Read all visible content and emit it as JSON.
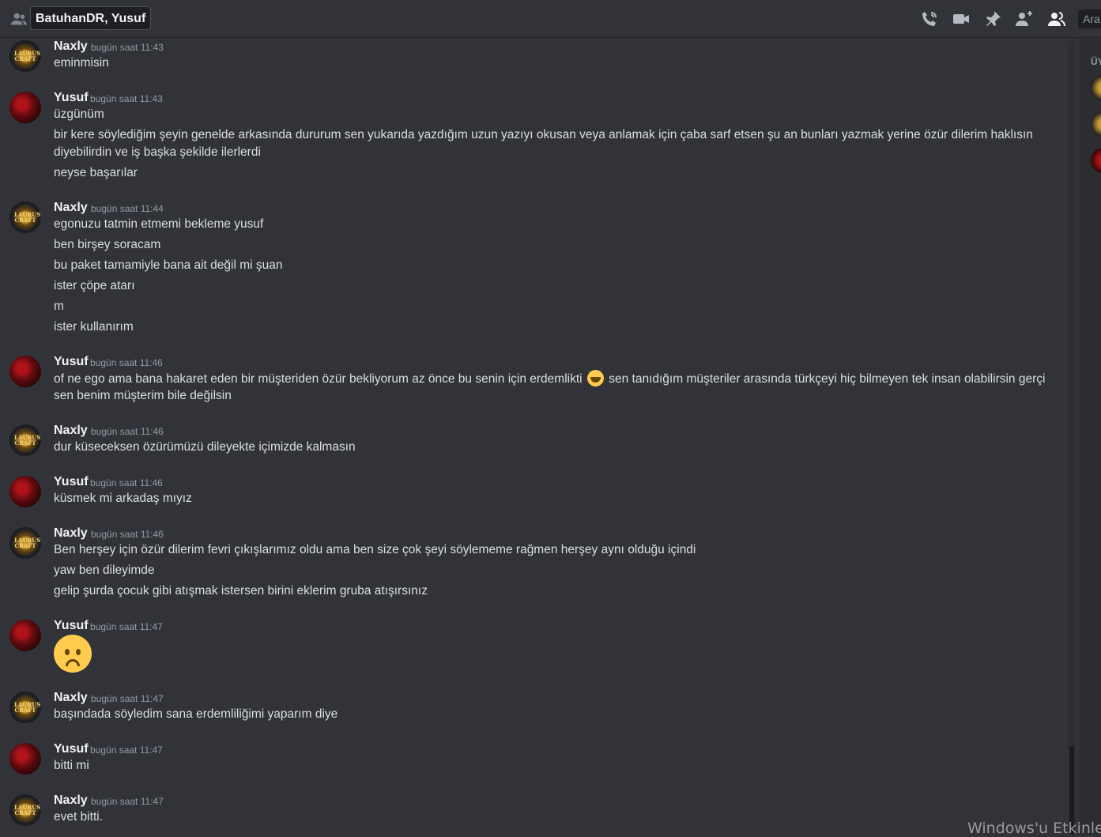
{
  "header": {
    "title": "BatuhanDR, Yusuf",
    "search_label": "Ara",
    "icons": [
      "friends-icon",
      "call-icon",
      "video-icon",
      "pin-icon",
      "add-member-icon",
      "members-icon"
    ]
  },
  "members_panel": {
    "heading": "ÜY"
  },
  "watermark": "Windows'u Etkinleş",
  "messages": [
    {
      "author": "Naxly",
      "time": "bugün saat 11:43",
      "lines": [
        "eminmisin"
      ]
    },
    {
      "author": "Yusuf",
      "time": "bugün saat 11:43",
      "lines": [
        "üzgünüm",
        "bir kere söylediğim şeyin genelde arkasında dururum sen yukarıda yazdığım uzun yazıyı okusan veya anlamak için çaba sarf etsen şu an bunları yazmak yerine özür dilerim haklısın",
        "diyebilirdin ve iş başka şekilde ilerlerdi",
        "neyse başarılar"
      ]
    },
    {
      "author": "Naxly",
      "time": "bugün saat 11:44",
      "lines": [
        "egonuzu tatmin etmemi bekleme yusuf",
        "ben birşey soracam",
        "bu paket tamamiyle bana ait değil mi şuan",
        "ister çöpe atarı",
        "m",
        "ister kullanırım"
      ]
    },
    {
      "author": "Yusuf",
      "time": "bugün saat 11:46",
      "lines": [
        "of ne ego ama bana hakaret eden bir müşteriden özür bekliyorum az önce bu senin için erdemlikti",
        "sen tanıdığım müşteriler arasında türkçeyi hiç bilmeyen tek insan olabilirsin gerçi",
        "sen benim müşterim bile değilsin"
      ]
    },
    {
      "author": "Naxly",
      "time": "bugün saat 11:46",
      "lines": [
        "dur küseceksen özürümüzü dileyekte içimizde kalmasın"
      ]
    },
    {
      "author": "Yusuf",
      "time": "bugün saat 11:46",
      "lines": [
        "küsmek mi arkadaş mıyız"
      ]
    },
    {
      "author": "Naxly",
      "time": "bugün saat 11:46",
      "lines": [
        "Ben herşey için özür dilerim fevri çıkışlarımız oldu ama ben size çok şeyi söylememe rağmen herşey aynı olduğu içindi",
        "yaw ben dileyimde",
        "gelip şurda çocuk gibi atışmak istersen birini eklerim gruba atışırsınız"
      ]
    },
    {
      "author": "Yusuf",
      "time": "bugün saat 11:47",
      "lines": [],
      "emoji": "frowning-face"
    },
    {
      "author": "Naxly",
      "time": "bugün saat 11:47",
      "lines": [
        "başındada söyledim sana erdemliliğimi yaparım diye"
      ]
    },
    {
      "author": "Yusuf",
      "time": "bugün saat 11:47",
      "lines": [
        "bitti mi"
      ]
    },
    {
      "author": "Naxly",
      "time": "bugün saat 11:47",
      "lines": [
        "evet bitti."
      ]
    }
  ]
}
